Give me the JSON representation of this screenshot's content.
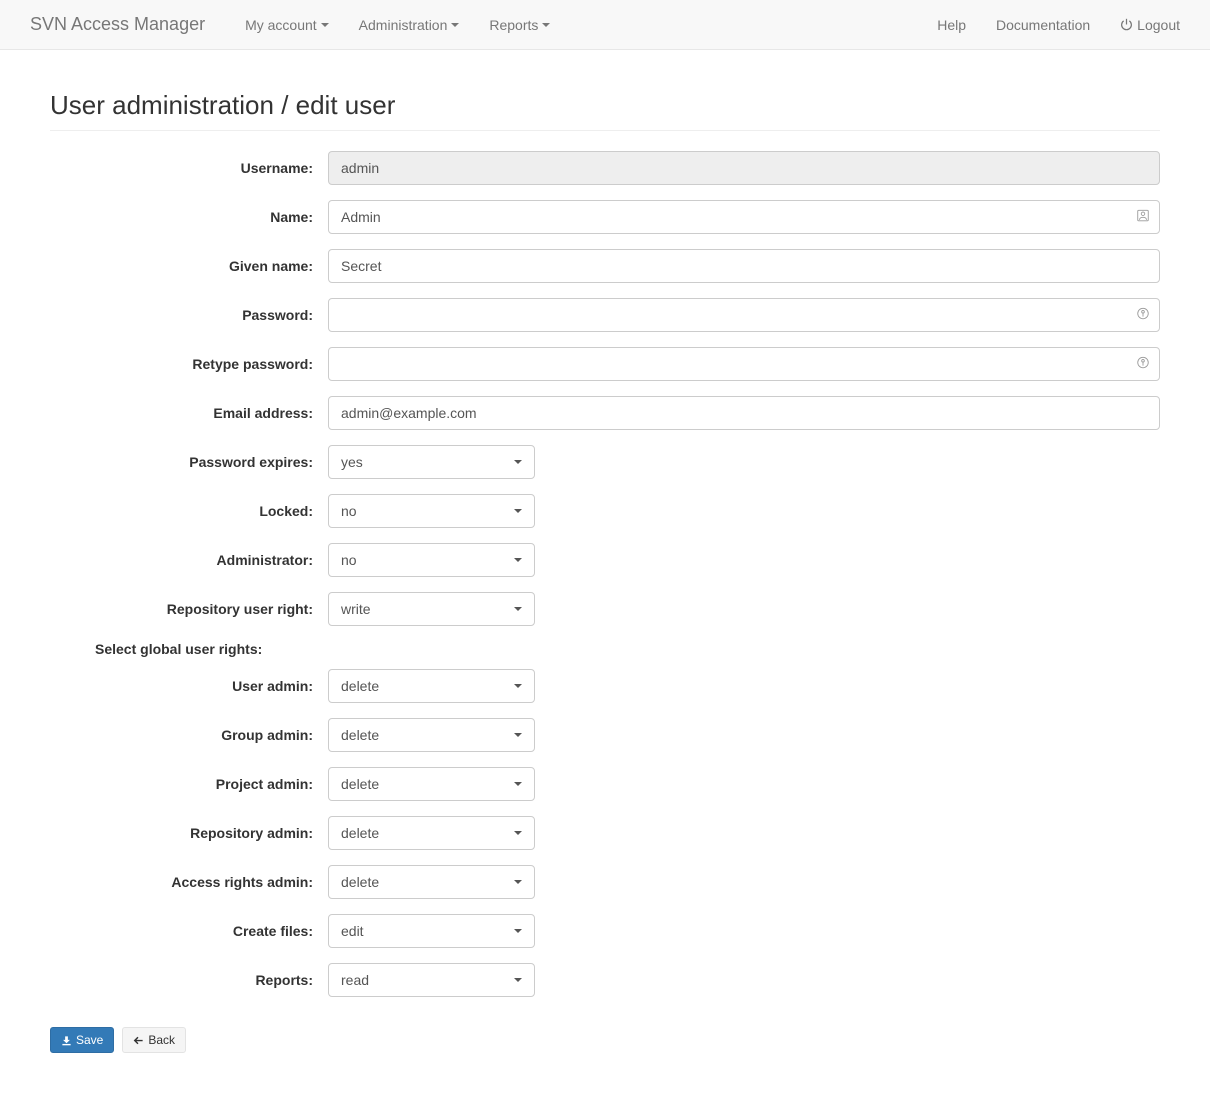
{
  "navbar": {
    "brand": "SVN Access Manager",
    "left": [
      "My account",
      "Administration",
      "Reports"
    ],
    "right": {
      "help": "Help",
      "documentation": "Documentation",
      "logout": "Logout"
    }
  },
  "page": {
    "title": "User administration / edit user"
  },
  "form": {
    "labels": {
      "username": "Username:",
      "name": "Name:",
      "given_name": "Given name:",
      "password": "Password:",
      "retype_password": "Retype password:",
      "email": "Email address:",
      "password_expires": "Password expires:",
      "locked": "Locked:",
      "administrator": "Administrator:",
      "repo_user_right": "Repository user right:",
      "section_global": "Select global user rights:",
      "user_admin": "User admin:",
      "group_admin": "Group admin:",
      "project_admin": "Project admin:",
      "repository_admin": "Repository admin:",
      "access_rights_admin": "Access rights admin:",
      "create_files": "Create files:",
      "reports": "Reports:"
    },
    "values": {
      "username": "admin",
      "name": "Admin",
      "given_name": "Secret",
      "password": "",
      "retype_password": "",
      "email": "admin@example.com",
      "password_expires": "yes",
      "locked": "no",
      "administrator": "no",
      "repo_user_right": "write",
      "user_admin": "delete",
      "group_admin": "delete",
      "project_admin": "delete",
      "repository_admin": "delete",
      "access_rights_admin": "delete",
      "create_files": "edit",
      "reports": "read"
    }
  },
  "buttons": {
    "save": "Save",
    "back": "Back"
  }
}
